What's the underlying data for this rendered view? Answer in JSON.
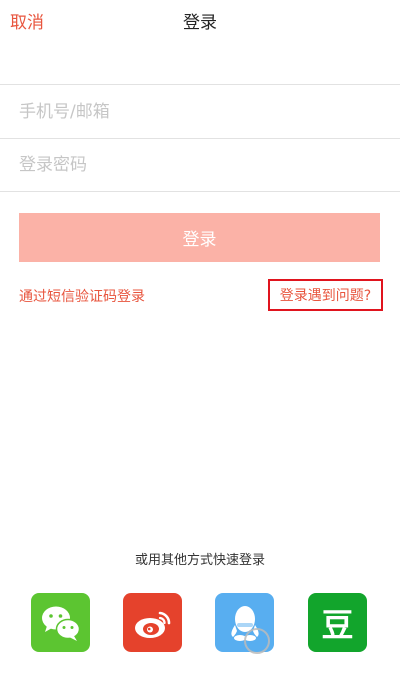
{
  "nav": {
    "cancel_label": "取消",
    "title": "登录"
  },
  "form": {
    "account_placeholder": "手机号/邮箱",
    "password_placeholder": "登录密码",
    "login_button_label": "登录"
  },
  "links": {
    "sms_login": "通过短信验证码登录",
    "login_problem": "登录遇到问题?"
  },
  "other_login": {
    "title": "或用其他方式快速登录",
    "providers": [
      {
        "name": "wechat",
        "icon": "wechat-icon",
        "color": "#5cc531"
      },
      {
        "name": "weibo",
        "icon": "weibo-icon",
        "color": "#e5422c"
      },
      {
        "name": "qq",
        "icon": "qq-icon",
        "color": "#58aef0"
      },
      {
        "name": "douban",
        "icon": "douban-icon",
        "color": "#12a52c",
        "glyph": "豆"
      }
    ]
  },
  "colors": {
    "accent": "#e8553e",
    "login_button_bg": "#fbb2a7",
    "highlight_border": "#e0141e"
  }
}
